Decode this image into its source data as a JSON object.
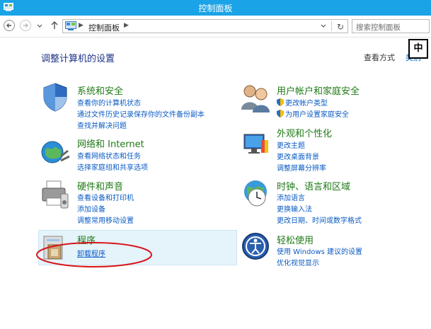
{
  "window": {
    "title": "控制面板"
  },
  "addressbar": {
    "breadcrumb": "控制面板",
    "search_placeholder": "搜索控制面板"
  },
  "header": {
    "title": "调整计算机的设置",
    "view_by": "查看方式",
    "view_value": "类别"
  },
  "ime": {
    "label": "中"
  },
  "categories": [
    {
      "title": "系统和安全",
      "icon": "security-shield-icon",
      "links": [
        "查看你的计算机状态",
        "通过文件历史记录保存你的文件备份副本",
        "查找并解决问题"
      ]
    },
    {
      "title": "网络和 Internet",
      "icon": "network-globe-icon",
      "links": [
        "查看网络状态和任务",
        "选择家庭组和共享选项"
      ]
    },
    {
      "title": "硬件和声音",
      "icon": "printer-icon",
      "links": [
        "查看设备和打印机",
        "添加设备",
        "调整常用移动设置"
      ]
    },
    {
      "title": "程序",
      "icon": "programs-icon",
      "links": [
        "卸载程序"
      ]
    },
    {
      "title": "用户帐户和家庭安全",
      "icon": "users-icon",
      "links": [
        "更改帐户类型",
        "为用户设置家庭安全"
      ]
    },
    {
      "title": "外观和个性化",
      "icon": "display-icon",
      "links": [
        "更改主题",
        "更改桌面背景",
        "调整屏幕分辨率"
      ]
    },
    {
      "title": "时钟、语言和区域",
      "icon": "clock-globe-icon",
      "links": [
        "添加语言",
        "更换输入法",
        "更改日期、时间或数字格式"
      ]
    },
    {
      "title": "轻松使用",
      "icon": "ease-of-access-icon",
      "links": [
        "使用 Windows 建议的设置",
        "优化视觉显示"
      ]
    }
  ],
  "colors": {
    "title_bar": "#1aa3e6",
    "category_title": "#1e7a15",
    "link": "#0a5bc4",
    "highlight": "#e5f3fb",
    "annotation": "#d8141b"
  }
}
